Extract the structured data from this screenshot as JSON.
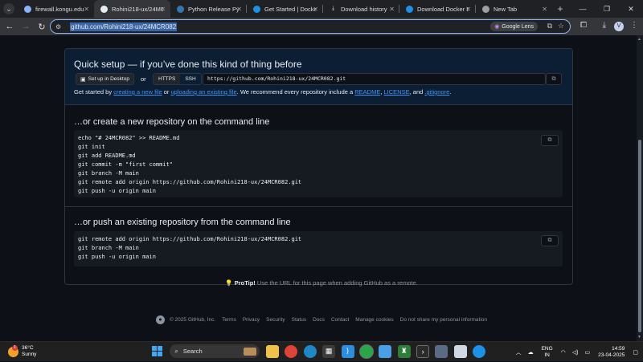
{
  "browser": {
    "tabs": [
      {
        "label": "firewall.kongu.edu",
        "icon": "globe-icon",
        "active": false
      },
      {
        "label": "Rohini218-ux/24MCR082",
        "icon": "github-icon",
        "active": true
      },
      {
        "label": "Python Release Python",
        "icon": "python-icon",
        "active": false
      },
      {
        "label": "Get Started | Docker",
        "icon": "docker-icon",
        "active": false
      },
      {
        "label": "Download history",
        "icon": "download-icon",
        "active": false
      },
      {
        "label": "Download Docker Desktop",
        "icon": "docker-icon",
        "active": false
      },
      {
        "label": "New Tab",
        "icon": "chrome-icon",
        "active": false
      }
    ],
    "new_tab": "+",
    "window_controls": {
      "minimize": "—",
      "maximize": "❐",
      "close": "✕"
    },
    "address": "github.com/Rohini218-ux/24MCR082",
    "google_lens": "Google Lens",
    "profile_initial": "V"
  },
  "page": {
    "quick_setup": {
      "title": "Quick setup — if you’ve done this kind of thing before",
      "setup_desktop": "Set up in Desktop",
      "or": "or",
      "https": "HTTPS",
      "ssh": "SSH",
      "clone_url": "https://github.com/Rohini218-ux/24MCR082.git",
      "help": {
        "p1": "Get started by ",
        "link1": "creating a new file",
        "p2": " or ",
        "link2": "uploading an existing file",
        "p3": ". We recommend every repository include a ",
        "link3": "README",
        "p4": ", ",
        "link4": "LICENSE",
        "p5": ", and ",
        "link5": ".gitignore",
        "p6": "."
      }
    },
    "create_new": {
      "title": "…or create a new repository on the command line",
      "lines": [
        "echo \"# 24MCR082\" >> README.md",
        "git init",
        "git add README.md",
        "git commit -m \"first commit\"",
        "git branch -M main",
        "git remote add origin https://github.com/Rohini218-ux/24MCR082.git",
        "git push -u origin main"
      ]
    },
    "push_existing": {
      "title": "…or push an existing repository from the command line",
      "lines": [
        "git remote add origin https://github.com/Rohini218-ux/24MCR082.git",
        "git branch -M main",
        "git push -u origin main"
      ]
    },
    "protip": {
      "label": "ProTip!",
      "text": " Use the URL for this page when adding GitHub as a remote."
    },
    "footer": [
      "© 2025 GitHub, Inc.",
      "Terms",
      "Privacy",
      "Security",
      "Status",
      "Docs",
      "Contact",
      "Manage cookies",
      "Do not share my personal information"
    ]
  },
  "taskbar": {
    "weather_temp": "36°C",
    "weather_desc": "Sunny",
    "weather_badge": "1",
    "search_label": "Search",
    "lang_top": "ENG",
    "lang_bottom": "IN",
    "time": "14:59",
    "date": "23-04-2025"
  }
}
